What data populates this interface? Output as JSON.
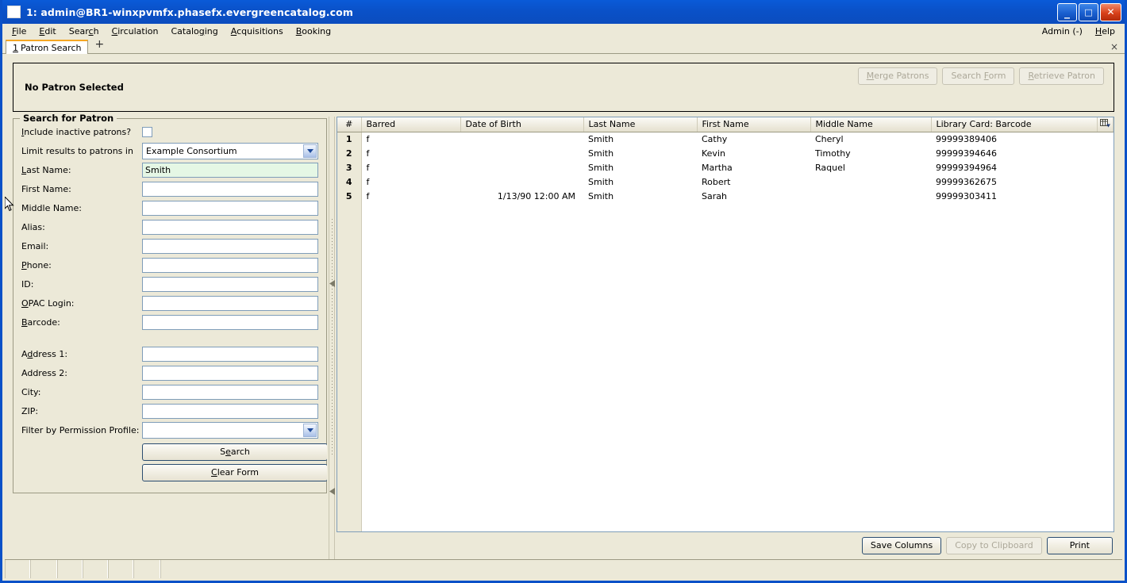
{
  "window": {
    "title": "1: admin@BR1-winxpvmfx.phasefx.evergreencatalog.com",
    "minimize_glyph": "_",
    "maximize_glyph": "□",
    "close_glyph": "✕"
  },
  "menubar": {
    "items": [
      {
        "label": "File",
        "accel": "F"
      },
      {
        "label": "Edit",
        "accel": "E"
      },
      {
        "label": "Search",
        "accel": "c"
      },
      {
        "label": "Circulation",
        "accel": "C"
      },
      {
        "label": "Cataloging",
        "accel": "g"
      },
      {
        "label": "Acquisitions",
        "accel": "A"
      },
      {
        "label": "Booking",
        "accel": "B"
      }
    ],
    "right_items": [
      {
        "label": "Admin (-)",
        "accel": ""
      },
      {
        "label": "Help",
        "accel": "H"
      }
    ]
  },
  "tabbar": {
    "tabs": [
      {
        "number": "1",
        "label": "Patron Search"
      }
    ],
    "add_label": "+",
    "close_label": "×"
  },
  "patron_header": {
    "title": "No Patron Selected",
    "actions": [
      {
        "label": "Merge Patrons",
        "accel": "M",
        "disabled": true
      },
      {
        "label": "Search Form",
        "accel": "F",
        "disabled": true
      },
      {
        "label": "Retrieve Patron",
        "accel": "R",
        "disabled": true
      }
    ]
  },
  "search_form": {
    "legend": "Search for Patron",
    "include_inactive_label": "Include inactive patrons?",
    "include_inactive_checked": false,
    "limit_results_label": "Limit results to patrons in",
    "limit_results_value": "Example Consortium",
    "fields": [
      {
        "label": "Last Name:",
        "value": "Smith",
        "active": true
      },
      {
        "label": "First Name:",
        "value": "",
        "active": false
      },
      {
        "label": "Middle Name:",
        "value": "",
        "active": false
      },
      {
        "label": "Alias:",
        "value": "",
        "active": false
      },
      {
        "label": "Email:",
        "value": "",
        "active": false
      },
      {
        "label": "Phone:",
        "value": "",
        "active": false
      },
      {
        "label": "ID:",
        "value": "",
        "active": false
      },
      {
        "label": "OPAC Login:",
        "value": "",
        "active": false
      },
      {
        "label": "Barcode:",
        "value": "",
        "active": false
      }
    ],
    "address_fields": [
      {
        "label": "Address 1:",
        "value": ""
      },
      {
        "label": "Address 2:",
        "value": ""
      },
      {
        "label": "City:",
        "value": ""
      },
      {
        "label": "ZIP:",
        "value": ""
      }
    ],
    "permission_profile_label": "Filter by Permission Profile:",
    "permission_profile_value": "",
    "search_button": "Search",
    "clear_button": "Clear Form"
  },
  "results": {
    "columns": [
      "#",
      "Barred",
      "Date of Birth",
      "Last Name",
      "First Name",
      "Middle Name",
      "Library Card: Barcode"
    ],
    "column_picker_icon": "column-picker-icon",
    "rows": [
      {
        "num": "1",
        "barred": "f",
        "dob": "",
        "last": "Smith",
        "first": "Cathy",
        "middle": "Cheryl",
        "barcode": "99999389406"
      },
      {
        "num": "2",
        "barred": "f",
        "dob": "",
        "last": "Smith",
        "first": "Kevin",
        "middle": "Timothy",
        "barcode": "99999394646"
      },
      {
        "num": "3",
        "barred": "f",
        "dob": "",
        "last": "Smith",
        "first": "Martha",
        "middle": "Raquel",
        "barcode": "99999394964"
      },
      {
        "num": "4",
        "barred": "f",
        "dob": "",
        "last": "Smith",
        "first": "Robert",
        "middle": "",
        "barcode": "99999362675"
      },
      {
        "num": "5",
        "barred": "f",
        "dob": "1/13/90 12:00 AM",
        "last": "Smith",
        "first": "Sarah",
        "middle": "",
        "barcode": "99999303411"
      }
    ],
    "footer_buttons": [
      {
        "label": "Save Columns",
        "disabled": false,
        "default": true
      },
      {
        "label": "Copy to Clipboard",
        "disabled": true,
        "default": false
      },
      {
        "label": "Print",
        "disabled": false,
        "default": true
      }
    ]
  },
  "colors": {
    "titlebar": "#0A51C8",
    "chrome": "#ECE9D8",
    "active_field": "#E5F7E5",
    "tab_accent": "#F5A623"
  }
}
